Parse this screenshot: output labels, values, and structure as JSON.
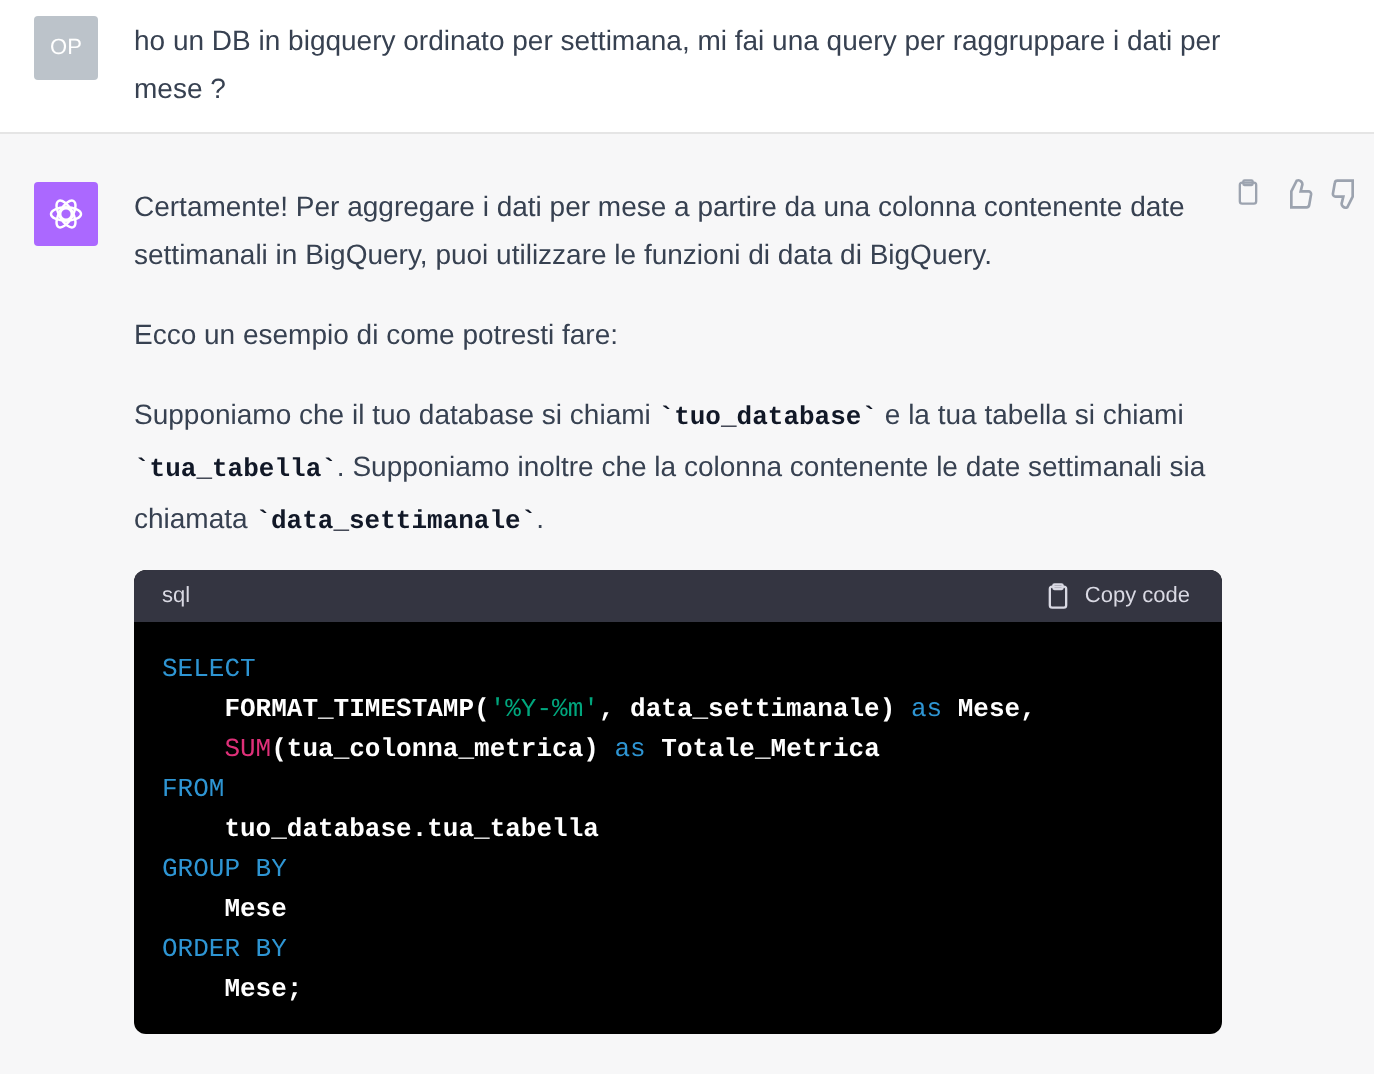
{
  "messages": [
    {
      "kind": "user",
      "avatar": "OP",
      "paragraphs": [
        [
          {
            "kind": "text",
            "text": "ho un DB in bigquery ordinato per settimana, mi fai una query per raggruppare i dati per mese ?"
          }
        ]
      ]
    },
    {
      "kind": "assistant",
      "paragraphs": [
        [
          {
            "kind": "text",
            "text": "Certamente! Per aggregare i dati per mese a partire da una colonna contenente date settimanali in BigQuery, puoi utilizzare le funzioni di data di BigQuery."
          }
        ],
        [
          {
            "kind": "text",
            "text": "Ecco un esempio di come potresti fare:"
          }
        ],
        [
          {
            "kind": "text",
            "text": "Supponiamo che il tuo database si chiami "
          },
          {
            "kind": "code",
            "text": "`tuo_database`"
          },
          {
            "kind": "text",
            "text": " e la tua tabella si chiami "
          },
          {
            "kind": "code",
            "text": "`tua_tabella`"
          },
          {
            "kind": "text",
            "text": ". Supponiamo inoltre che la colonna contenente le date settimanali sia chiamata "
          },
          {
            "kind": "code",
            "text": "`data_settimanale`"
          },
          {
            "kind": "text",
            "text": "."
          }
        ]
      ],
      "code_block": {
        "language": "sql",
        "copy_label": "Copy code",
        "lines": [
          {
            "indent": false,
            "tokens": [
              {
                "kind": "keyword",
                "text": "SELECT"
              }
            ]
          },
          {
            "indent": true,
            "tokens": [
              {
                "kind": "plain",
                "text": "FORMAT_TIMESTAMP("
              },
              {
                "kind": "string",
                "text": "'%Y-%m'"
              },
              {
                "kind": "plain",
                "text": ", data_settimanale) "
              },
              {
                "kind": "keyword",
                "text": "as"
              },
              {
                "kind": "plain",
                "text": " Mese,"
              }
            ]
          },
          {
            "indent": true,
            "tokens": [
              {
                "kind": "func",
                "text": "SUM"
              },
              {
                "kind": "plain",
                "text": "(tua_colonna_metrica) "
              },
              {
                "kind": "keyword",
                "text": "as"
              },
              {
                "kind": "plain",
                "text": " Totale_Metrica"
              }
            ]
          },
          {
            "indent": false,
            "tokens": [
              {
                "kind": "keyword",
                "text": "FROM"
              }
            ]
          },
          {
            "indent": true,
            "tokens": [
              {
                "kind": "plain",
                "text": "tuo_database.tua_tabella"
              }
            ]
          },
          {
            "indent": false,
            "tokens": [
              {
                "kind": "keyword",
                "text": "GROUP BY"
              }
            ]
          },
          {
            "indent": true,
            "tokens": [
              {
                "kind": "plain",
                "text": "Mese"
              }
            ]
          },
          {
            "indent": false,
            "tokens": [
              {
                "kind": "keyword",
                "text": "ORDER BY"
              }
            ]
          },
          {
            "indent": true,
            "tokens": [
              {
                "kind": "plain",
                "text": "Mese;"
              }
            ]
          }
        ]
      }
    }
  ]
}
